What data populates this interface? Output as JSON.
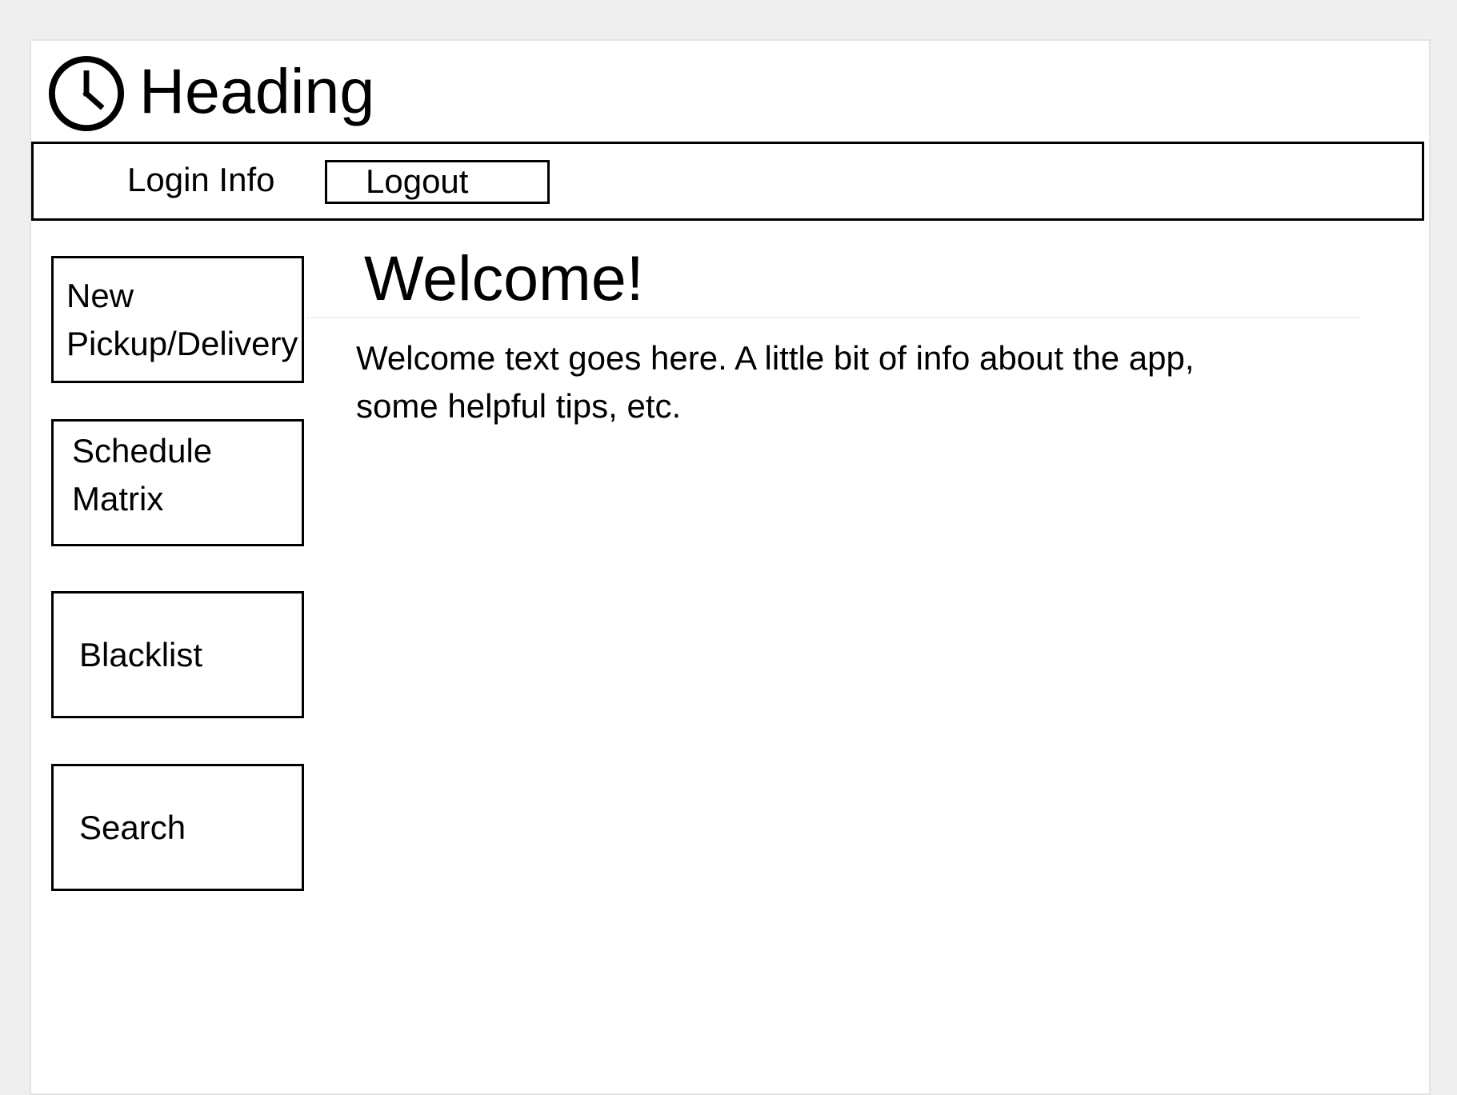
{
  "header": {
    "icon": "clock-icon",
    "title": "Heading"
  },
  "topbar": {
    "login_info": "Login Info",
    "logout_label": "Logout"
  },
  "sidebar": {
    "items": [
      {
        "line1": "New",
        "line2": "Pickup/Delivery"
      },
      {
        "line1": "Schedule",
        "line2": "Matrix"
      },
      {
        "label": "Blacklist"
      },
      {
        "label": "Search"
      }
    ]
  },
  "main": {
    "title": "Welcome!",
    "text": "Welcome text goes here. A little bit of info about the app, some helpful tips, etc."
  }
}
